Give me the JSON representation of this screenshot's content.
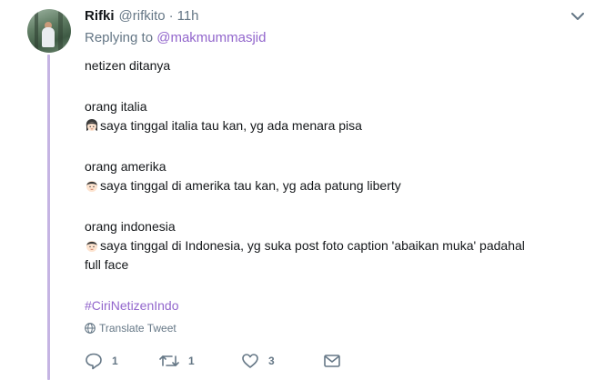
{
  "tweet": {
    "display_name": "Rifki",
    "handle": "@rifkito",
    "separator": "·",
    "time": "11h",
    "replying_to_prefix": "Replying to",
    "replying_to_mention": "@makmummasjid",
    "lines": {
      "intro": "netizen ditanya",
      "italy_heading": "orang italia",
      "italy_text": "saya tinggal italia tau kan, yg ada menara pisa",
      "america_heading": "orang amerika",
      "america_text": "saya tinggal di amerika tau kan, yg ada patung liberty",
      "indonesia_heading": "orang indonesia",
      "indonesia_text_1": "saya tinggal di Indonesia, yg suka post foto caption 'abaikan muka' padahal",
      "indonesia_text_2": "full face",
      "hashtag": "#CiriNetizenIndo"
    },
    "emojis": [
      "woman-face-emoji",
      "man-face-emoji",
      "man-face-emoji"
    ],
    "translate_label": "Translate Tweet",
    "actions": {
      "reply_count": "1",
      "retweet_count": "1",
      "like_count": "3"
    }
  },
  "colors": {
    "accent": "#9266cc",
    "thread_line": "#c5b4e3",
    "secondary_text": "#657786"
  }
}
